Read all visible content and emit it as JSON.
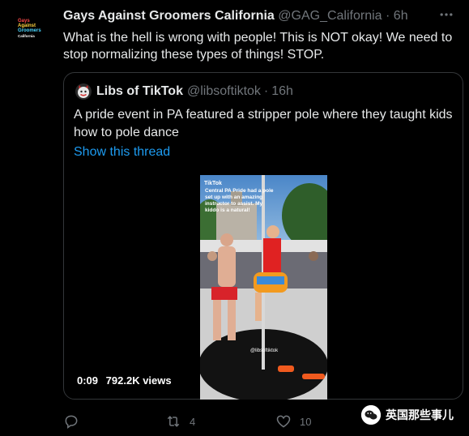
{
  "tweet": {
    "author_name": "Gays Against Groomers California",
    "author_handle": "@GAG_California",
    "separator": "·",
    "time": "6h",
    "avatar_logo": [
      "Gays",
      "Against",
      "Groomers",
      "California"
    ],
    "text": "What is the hell is wrong with people! This is NOT okay! We need to stop normalizing these types of things! STOP."
  },
  "quote": {
    "author_name": "Libs of TikTok",
    "author_handle": "@libsoftiktok",
    "separator": "·",
    "time": "16h",
    "text": "A pride event in PA featured a stripper pole where they taught kids how to pole dance",
    "show_thread": "Show this thread",
    "video": {
      "duration": "0:09",
      "views": "792.2K views",
      "tiktok_label": "TikTok",
      "caption": "Central PA Pride had a pole set up with an amazing instructor to assist. My kiddo is a natural!",
      "watermark_handle": "@libsoftiktok"
    }
  },
  "actions": {
    "reply_count": "",
    "retweet_count": "4",
    "like_count": "10",
    "share_count": ""
  },
  "watermark": {
    "text": "英国那些事儿"
  },
  "colors": {
    "background": "#000000",
    "text": "#e7e9ea",
    "secondary": "#71767b",
    "link": "#1d9bf0",
    "border": "#333639"
  }
}
